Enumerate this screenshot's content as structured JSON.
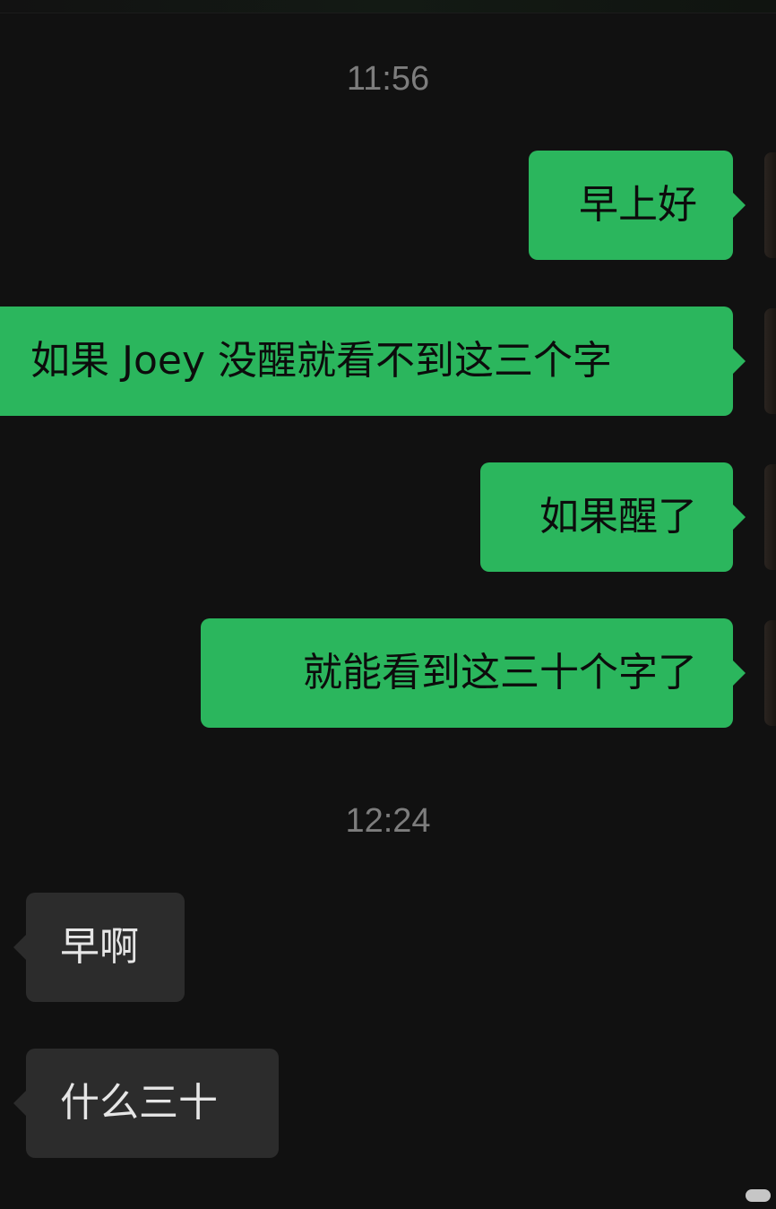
{
  "chat": {
    "groups": [
      {
        "time": "11:56",
        "messages": [
          {
            "direction": "outgoing",
            "text": "早上好"
          },
          {
            "direction": "outgoing",
            "text": "如果 Joey 没醒就看不到这三个字"
          },
          {
            "direction": "outgoing",
            "text": "如果醒了"
          },
          {
            "direction": "outgoing",
            "text": "就能看到这三十个字了"
          }
        ]
      },
      {
        "time": "12:24",
        "messages": [
          {
            "direction": "incoming",
            "text": "早啊"
          },
          {
            "direction": "incoming",
            "text": "什么三十"
          }
        ]
      }
    ]
  },
  "colors": {
    "background": "#111111",
    "outgoing_bubble": "#2bb65d",
    "incoming_bubble": "#2c2c2c",
    "timestamp_text": "#7d7d7d"
  }
}
